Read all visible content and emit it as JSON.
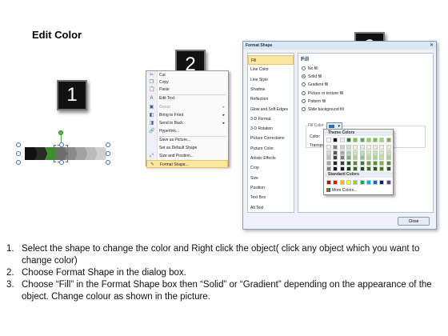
{
  "title": "Edit Color",
  "steps": {
    "one": "1",
    "two": "2",
    "three": "3"
  },
  "context_menu": {
    "items": [
      {
        "icon": "cut-icon",
        "glyph": "✂",
        "label": "Cut",
        "disabled": false,
        "submenu": false
      },
      {
        "icon": "copy-icon",
        "glyph": "❐",
        "label": "Copy",
        "disabled": false,
        "submenu": false
      },
      {
        "icon": "paste-icon",
        "glyph": "📋",
        "label": "Paste",
        "disabled": false,
        "submenu": false
      },
      {
        "icon": "edit-text-icon",
        "glyph": "A",
        "label": "Edit Text",
        "disabled": false,
        "submenu": false
      },
      {
        "icon": "group-icon",
        "glyph": "▣",
        "label": "Group",
        "disabled": true,
        "submenu": true
      },
      {
        "icon": "bring-to-front-icon",
        "glyph": "◧",
        "label": "Bring to Front",
        "disabled": false,
        "submenu": true
      },
      {
        "icon": "send-to-back-icon",
        "glyph": "◨",
        "label": "Send to Back",
        "disabled": false,
        "submenu": true
      },
      {
        "icon": "hyperlink-icon",
        "glyph": "🔗",
        "label": "Hyperlink...",
        "disabled": false,
        "submenu": false
      },
      {
        "icon": "",
        "glyph": "",
        "label": "Save as Picture...",
        "disabled": false,
        "submenu": false
      },
      {
        "icon": "",
        "glyph": "",
        "label": "Set as Default Shape",
        "disabled": false,
        "submenu": false
      },
      {
        "icon": "size-position-icon",
        "glyph": "⤢",
        "label": "Size and Position...",
        "disabled": false,
        "submenu": false
      },
      {
        "icon": "format-shape-icon",
        "glyph": "✎",
        "label": "Format Shape...",
        "disabled": false,
        "submenu": false,
        "highlighted": true
      }
    ]
  },
  "dialog": {
    "title": "Format Shape",
    "close_glyph": "✕",
    "categories": [
      "Fill",
      "Line Color",
      "Line Style",
      "Shadow",
      "Reflection",
      "Glow and Soft Edges",
      "3-D Format",
      "3-D Rotation",
      "Picture Corrections",
      "Picture Color",
      "Artistic Effects",
      "Crop",
      "Size",
      "Position",
      "Text Box",
      "Alt Text"
    ],
    "selected_category": "Fill",
    "fill": {
      "heading": "Fill",
      "options": [
        {
          "label": "No fill",
          "checked": false
        },
        {
          "label": "Solid fill",
          "checked": true
        },
        {
          "label": "Gradient fill",
          "checked": false
        },
        {
          "label": "Picture or texture fill",
          "checked": false
        },
        {
          "label": "Pattern fill",
          "checked": false
        },
        {
          "label": "Slide background fill",
          "checked": false
        }
      ],
      "group_label": "Fill Color",
      "color_label": "Color:",
      "transparency_label": "Transpa"
    },
    "close_button": "Close"
  },
  "palette": {
    "theme_heading": "Theme Colors",
    "standard_heading": "Standard Colors",
    "more_colors": "More Colors...",
    "theme_columns": [
      [
        "#ffffff",
        "#f2f2f2",
        "#d9d9d9",
        "#bfbfbf",
        "#a6a6a6",
        "#808080"
      ],
      [
        "#000000",
        "#7f7f7f",
        "#595959",
        "#3f3f3f",
        "#262626",
        "#0d0d0d"
      ],
      [
        "#eeeeee",
        "#d0d0d0",
        "#a8a8a8",
        "#7a7a7a",
        "#3d3d3d",
        "#1a1a1a"
      ],
      [
        "#2e7d32",
        "#c8e6c9",
        "#a5d6a7",
        "#66bb6a",
        "#1b5e20",
        "#0d3a10"
      ],
      [
        "#8bc34a",
        "#e8f5d6",
        "#cfe9a8",
        "#aed581",
        "#558b2f",
        "#33691e"
      ],
      [
        "#4caf50",
        "#d7f0d8",
        "#b2dfb4",
        "#81c784",
        "#2e7d32",
        "#1b4d1e"
      ],
      [
        "#9ccc65",
        "#eef7e2",
        "#d4ebb3",
        "#b7dc8a",
        "#689f38",
        "#3e6b1e"
      ],
      [
        "#66cc33",
        "#e2f5d5",
        "#c2eaa7",
        "#9edc72",
        "#4a9a22",
        "#2c5c14"
      ],
      [
        "#a5d86e",
        "#f0f8e6",
        "#dcefc4",
        "#c4e39c",
        "#7cb342",
        "#4a7a1f"
      ],
      [
        "#7cb342",
        "#e6f1d8",
        "#cbe2ae",
        "#aed581",
        "#558b2f",
        "#33521a"
      ]
    ],
    "standard": [
      "#c00000",
      "#ff0000",
      "#ffc000",
      "#ffff00",
      "#92d050",
      "#00b050",
      "#00b0f0",
      "#0070c0",
      "#002060",
      "#7030a0"
    ]
  },
  "shape_strip": {
    "segments": [
      "#111111",
      "#2a2a2a",
      "#3f8f2a",
      "#6e6e6e",
      "#8a8a8a",
      "#a2a2a2",
      "#bbbbbb",
      "#cfcfcf"
    ]
  },
  "instructions": [
    {
      "num": "1.",
      "text": "Select the shape to change the color and Right click the object( click any object which you want to change color)"
    },
    {
      "num": "2.",
      "text": "Choose Format Shape in the dialog box."
    },
    {
      "num": "3.",
      "text": "Choose “Fill” in the Format Shape box then “Solid” or “Gradient” depending on the appearance of the object. Change colour as shown in the picture."
    }
  ]
}
